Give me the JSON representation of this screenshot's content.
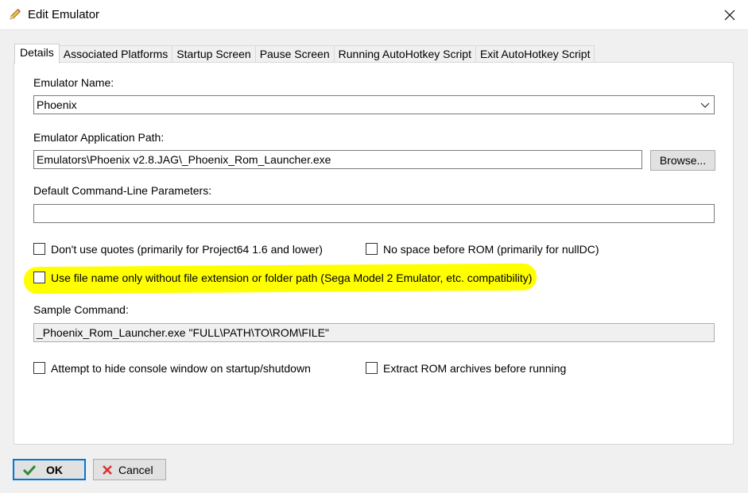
{
  "window": {
    "title": "Edit Emulator"
  },
  "tabs": [
    {
      "label": "Details"
    },
    {
      "label": "Associated Platforms"
    },
    {
      "label": "Startup Screen"
    },
    {
      "label": "Pause Screen"
    },
    {
      "label": "Running AutoHotkey Script"
    },
    {
      "label": "Exit AutoHotkey Script"
    }
  ],
  "details": {
    "name_label": "Emulator Name:",
    "name_value": "Phoenix",
    "path_label": "Emulator Application Path:",
    "path_value": "Emulators\\Phoenix v2.8.JAG\\_Phoenix_Rom_Launcher.exe",
    "browse_label": "Browse...",
    "params_label": "Default Command-Line Parameters:",
    "params_value": "",
    "chk_no_quotes": "Don't use quotes (primarily for Project64 1.6 and lower)",
    "chk_no_space": "No space before ROM (primarily for nullDC)",
    "chk_filename_only": "Use file name only without file extension or folder path (Sega Model 2 Emulator, etc. compatibility)",
    "sample_label": "Sample Command:",
    "sample_value": "_Phoenix_Rom_Launcher.exe \"FULL\\PATH\\TO\\ROM\\FILE\"",
    "chk_hide_console": "Attempt to hide console window on startup/shutdown",
    "chk_extract": "Extract ROM archives before running"
  },
  "footer": {
    "ok_label": "OK",
    "cancel_label": "Cancel"
  },
  "colors": {
    "highlight": "#ffff00",
    "ok_check": "#2e8b2e",
    "cancel_x": "#d9302c",
    "focus_border": "#0078d7"
  }
}
